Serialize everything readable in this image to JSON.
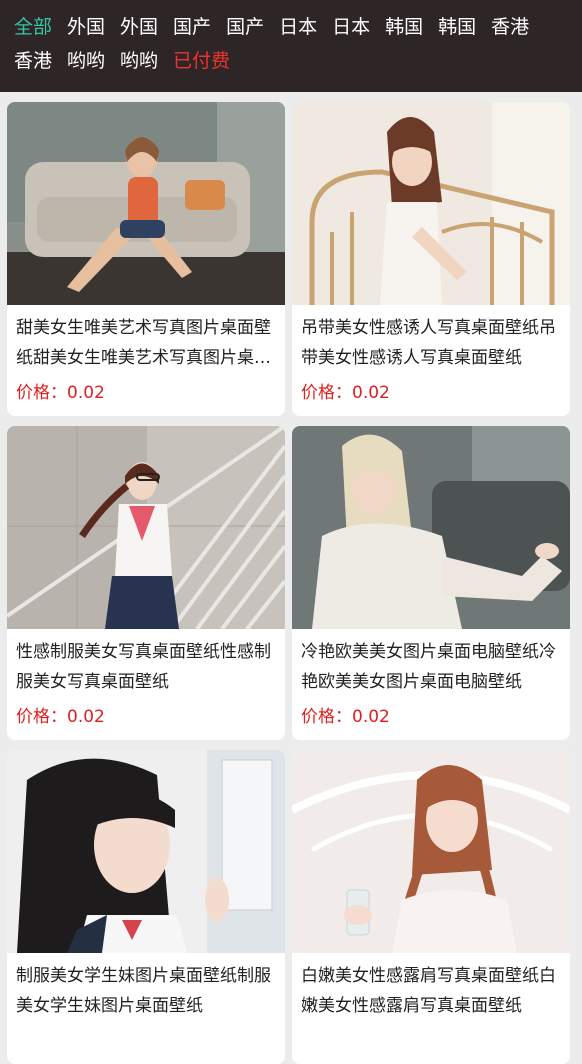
{
  "nav": {
    "tabs": [
      {
        "label": "全部",
        "state": "active"
      },
      {
        "label": "外国",
        "state": "normal"
      },
      {
        "label": "外国",
        "state": "normal"
      },
      {
        "label": "国产",
        "state": "normal"
      },
      {
        "label": "国产",
        "state": "normal"
      },
      {
        "label": "日本",
        "state": "normal"
      },
      {
        "label": "日本",
        "state": "normal"
      },
      {
        "label": "韩国",
        "state": "normal"
      },
      {
        "label": "韩国",
        "state": "normal"
      },
      {
        "label": "香港",
        "state": "normal"
      },
      {
        "label": "香港",
        "state": "normal"
      },
      {
        "label": "哟哟",
        "state": "normal"
      },
      {
        "label": "哟哟",
        "state": "normal"
      },
      {
        "label": "已付费",
        "state": "paid"
      }
    ]
  },
  "colors": {
    "topbar_bg": "#2e2526",
    "tab_active": "#35c6a3",
    "tab_paid": "#f03232",
    "price": "#e02020",
    "page_bg": "#ececec"
  },
  "cards": [
    {
      "title": "甜美女生唯美艺术写真图片桌面壁纸甜美女生唯美艺术写真图片桌面壁纸",
      "price": "价格：0.02"
    },
    {
      "title": "吊带美女性感诱人写真桌面壁纸吊带美女性感诱人写真桌面壁纸",
      "price": "价格：0.02"
    },
    {
      "title": "性感制服美女写真桌面壁纸性感制服美女写真桌面壁纸",
      "price": "价格：0.02"
    },
    {
      "title": "冷艳欧美美女图片桌面电脑壁纸冷艳欧美美女图片桌面电脑壁纸",
      "price": "价格：0.02"
    },
    {
      "title": "制服美女学生妹图片桌面壁纸制服美女学生妹图片桌面壁纸",
      "price": ""
    },
    {
      "title": "白嫩美女性感露肩写真桌面壁纸白嫩美女性感露肩写真桌面壁纸",
      "price": ""
    }
  ]
}
